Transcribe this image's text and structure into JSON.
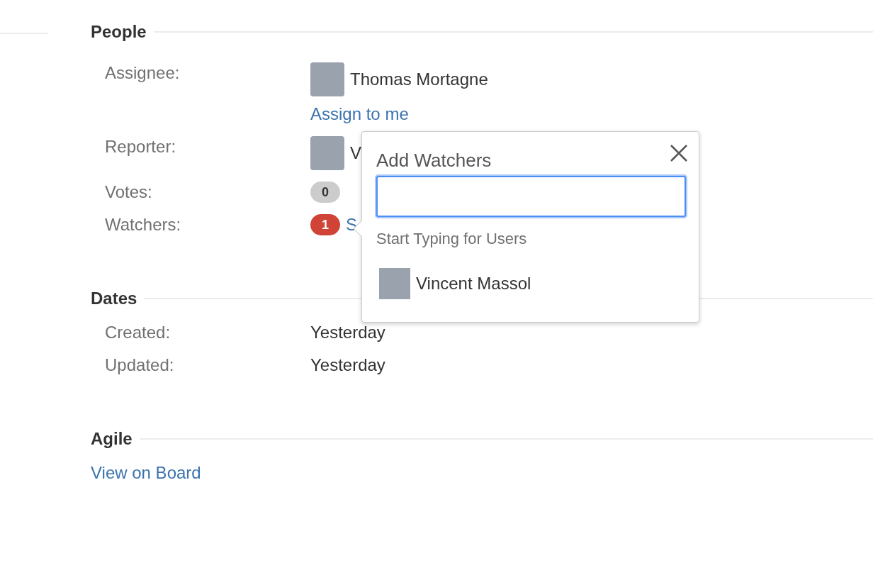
{
  "sections": [
    {
      "title": "People",
      "fields": [
        {
          "kind": "user",
          "label": "Assignee:",
          "value": "Thomas Mortagne",
          "link": "Assign to me"
        },
        {
          "kind": "user",
          "label": "Reporter:",
          "value": "V"
        },
        {
          "kind": "count",
          "label": "Votes:",
          "count": "0",
          "color": "#cccccc"
        },
        {
          "kind": "count",
          "label": "Watchers:",
          "count": "1",
          "color": "#d04437",
          "link": "S"
        }
      ]
    },
    {
      "title": "Dates",
      "fields": [
        {
          "kind": "text",
          "label": "Created:",
          "value": "Yesterday"
        },
        {
          "kind": "text",
          "label": "Updated:",
          "value": "Yesterday"
        }
      ]
    },
    {
      "title": "Agile",
      "fields": [
        {
          "kind": "link",
          "link": "View on Board"
        }
      ]
    }
  ],
  "popup": {
    "title": "Add Watchers",
    "hint": "Start Typing for Users",
    "users": [
      "Vincent Massol"
    ]
  }
}
